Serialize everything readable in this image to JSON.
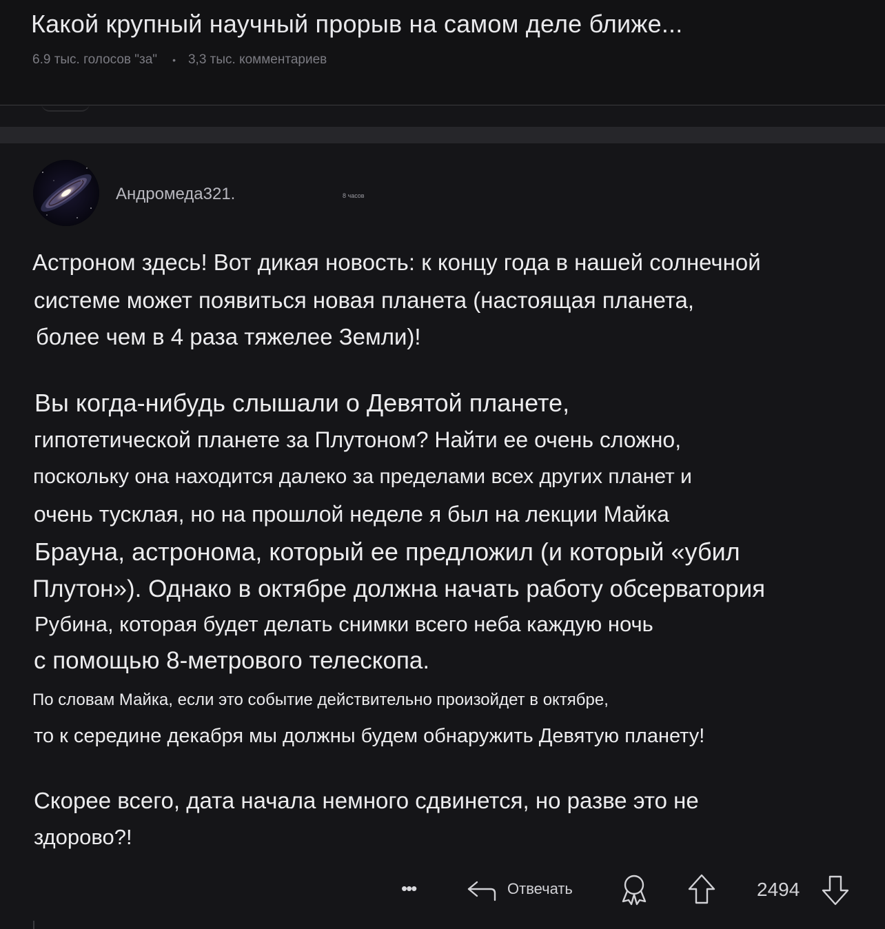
{
  "post": {
    "title": "Какой крупный научный прорыв на самом деле ближе...",
    "upvotes": "6.9 тыс. голосов \"за\"",
    "separator": "•",
    "comments": "3,3 тыс. комментариев"
  },
  "comment": {
    "username": "Андромеда321.",
    "timestamp": "8 часов",
    "lines": [
      "Астроном здесь! Вот дикая новость: к концу года в нашей солнечной",
      "системе может появиться новая планета (настоящая планета,",
      "более чем в 4 раза тяжелее Земли)!",
      "Вы когда-нибудь слышали о Девятой планете,",
      "гипотетической планете за Плутоном? Найти ее очень сложно,",
      "поскольку она находится далеко за пределами всех других планет и",
      "очень тусклая, но на прошлой неделе я был на лекции Майка",
      "Брауна, астронома, который ее предложил (и который «убил",
      "Плутон»). Однако в октябре должна начать работу обсерватория",
      "Рубина, которая будет делать снимки всего неба каждую ночь",
      "с помощью 8-метрового телескопа.",
      "По словам Майка, если это событие действительно произойдет в октябре,",
      "то к середине декабря мы должны будем обнаружить Девятую планету!",
      "Скорее всего, дата начала немного сдвинется, но разве это не",
      "здорово?!"
    ]
  },
  "actions": {
    "more_icon": "more-horizontal-icon",
    "more_glyph": "•••",
    "reply_label": "Отвечать",
    "award_icon": "award-icon",
    "upvote_icon": "upvote-arrow-icon",
    "vote_count": "2494",
    "downvote_icon": "downvote-arrow-icon"
  },
  "colors": {
    "background": "#151518",
    "header_background": "#121214",
    "text": "#ececee",
    "muted_text": "#7b7b82"
  }
}
